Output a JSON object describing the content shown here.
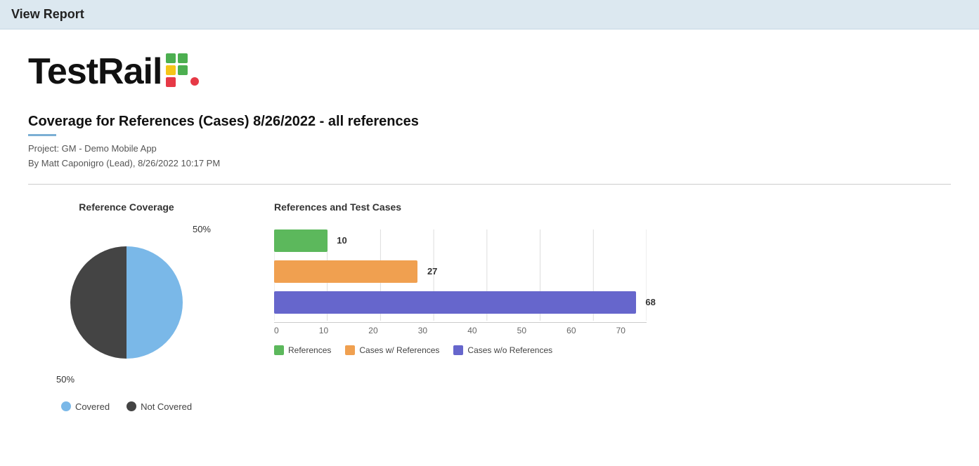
{
  "header": {
    "title": "View Report"
  },
  "logo": {
    "text": "TestRail",
    "grid_colors": [
      "#4caf50",
      "#4caf50",
      "#f5c518",
      "#4caf50",
      "#e63946",
      "#4caf50"
    ],
    "dot_color": "#e63946"
  },
  "report": {
    "title": "Coverage for References (Cases) 8/26/2022 - all references",
    "project": "Project: GM - Demo Mobile App",
    "author": "By Matt Caponigro (Lead), 8/26/2022 10:17 PM"
  },
  "pie_chart": {
    "title": "Reference Coverage",
    "covered_pct": "50%",
    "not_covered_pct": "50%",
    "covered_color": "#7ab8e8",
    "not_covered_color": "#444",
    "legend": [
      {
        "label": "Covered",
        "color": "#7ab8e8"
      },
      {
        "label": "Not Covered",
        "color": "#444"
      }
    ]
  },
  "bar_chart": {
    "title": "References and Test Cases",
    "max_value": 70,
    "bars": [
      {
        "label": "References",
        "value": 10,
        "color": "#5cb85c"
      },
      {
        "label": "Cases w/ References",
        "value": 27,
        "color": "#f0a050"
      },
      {
        "label": "Cases w/o References",
        "value": 68,
        "color": "#6666cc"
      }
    ],
    "x_axis": [
      "0",
      "10",
      "20",
      "30",
      "40",
      "50",
      "60",
      "70"
    ]
  }
}
